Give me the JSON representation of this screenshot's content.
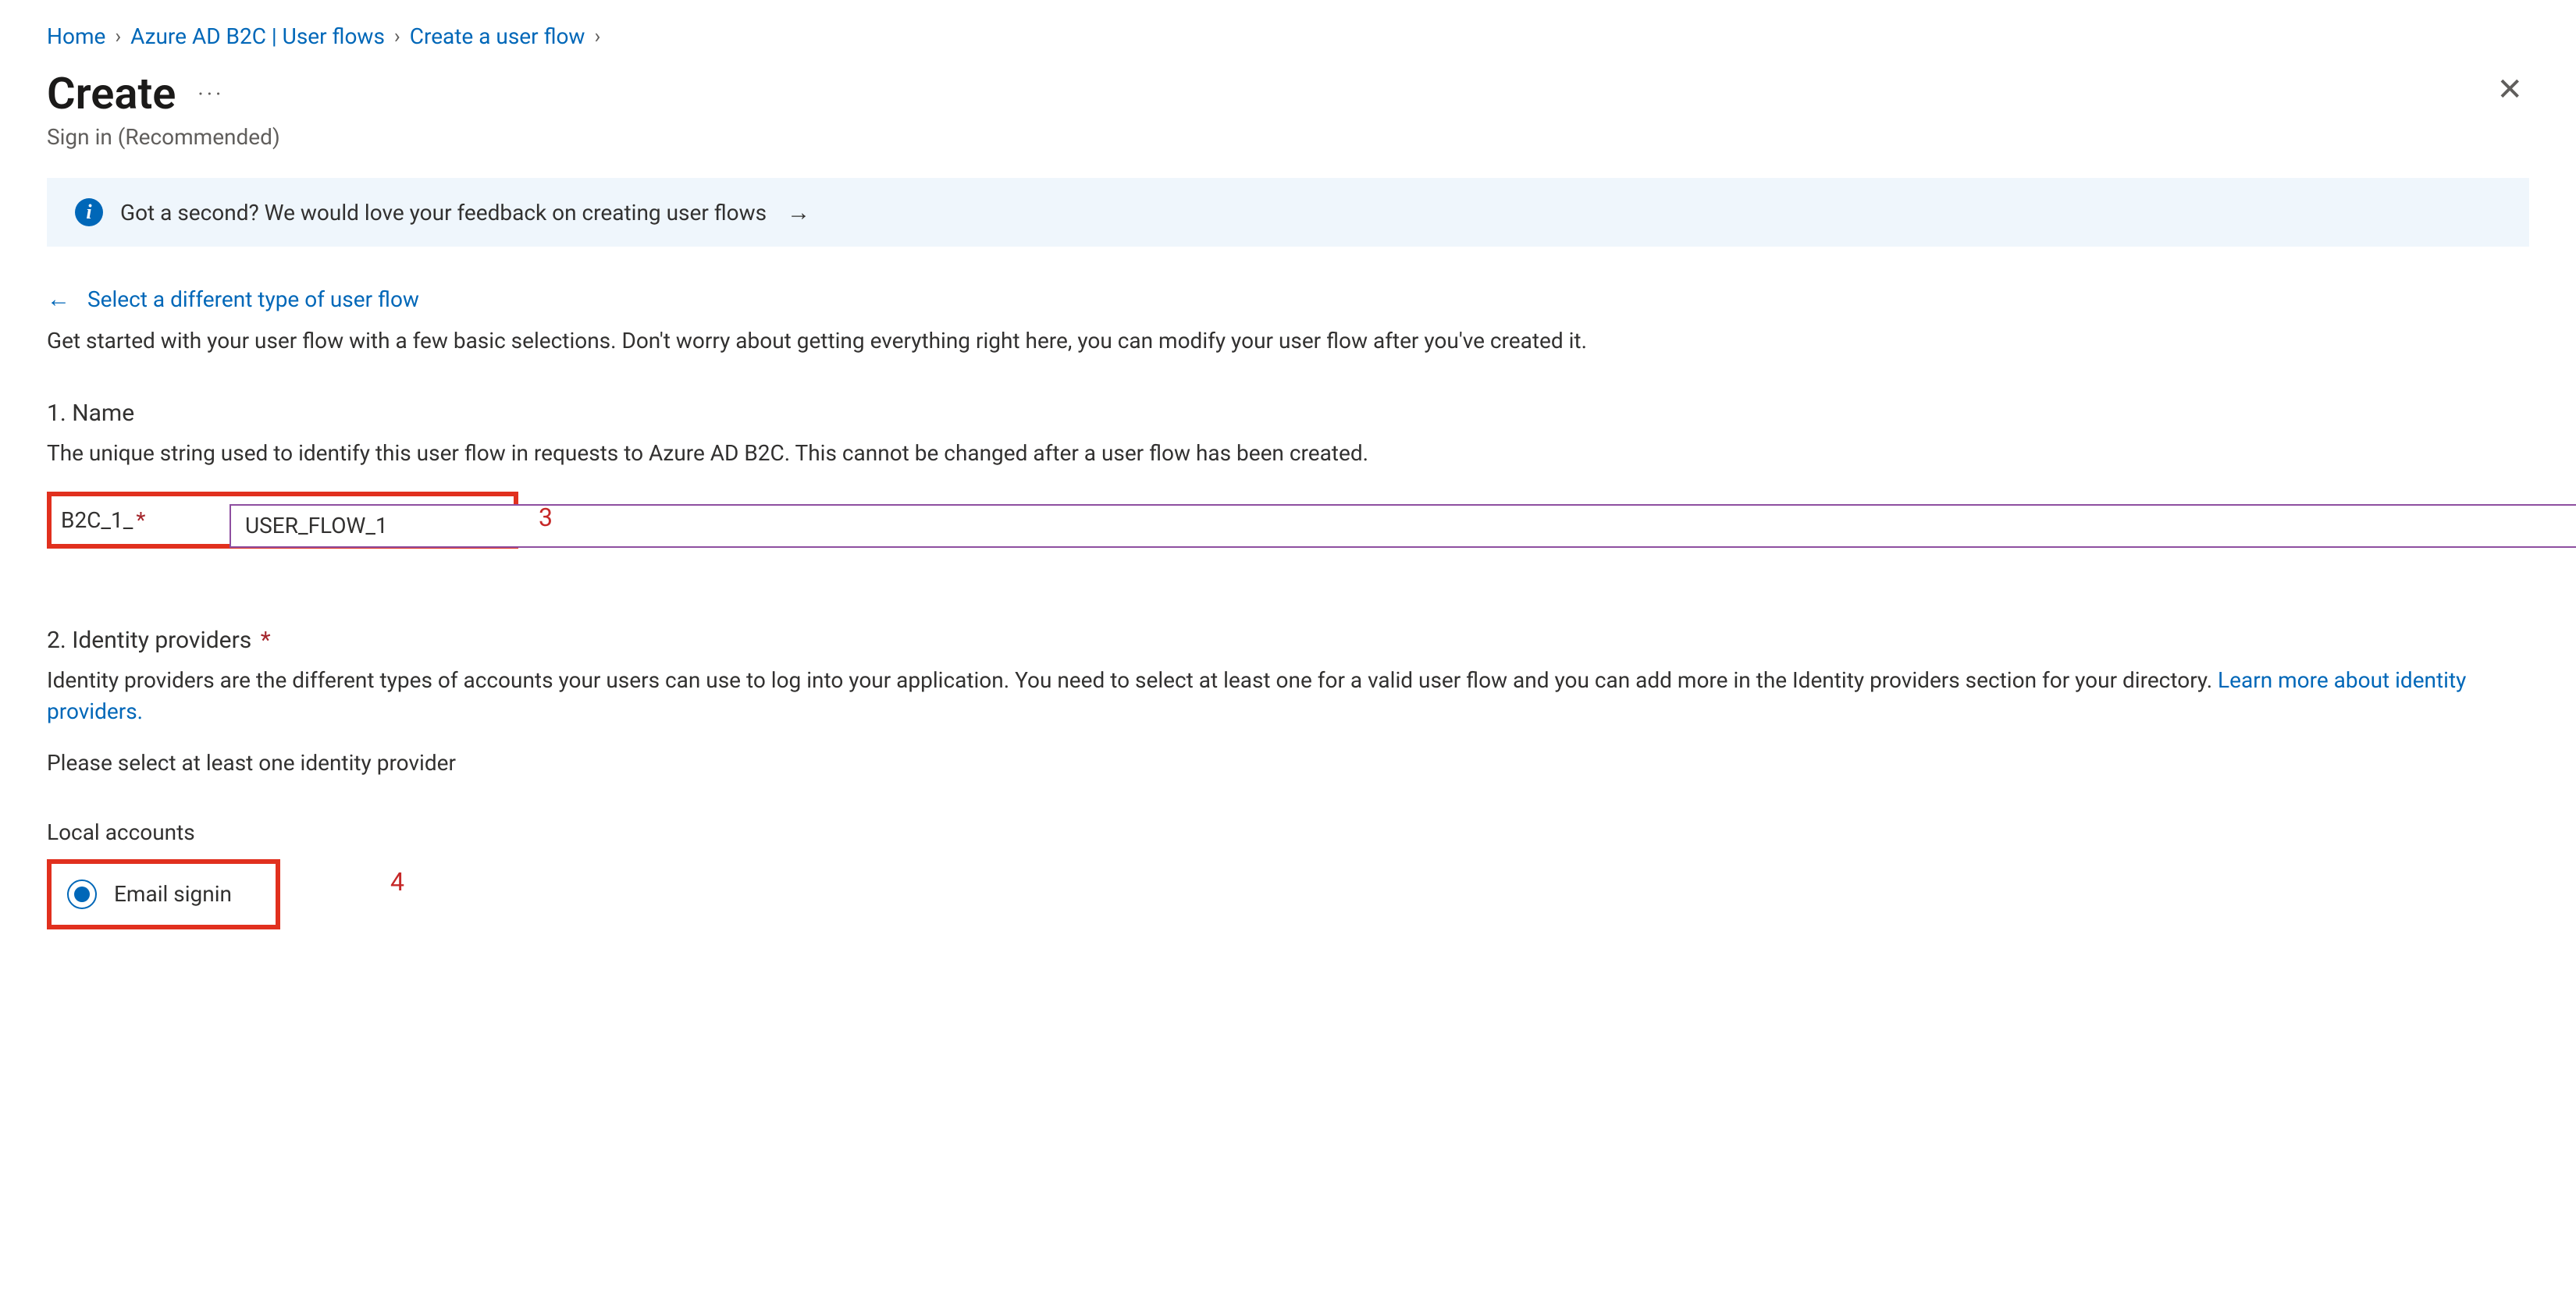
{
  "breadcrumb": {
    "items": [
      "Home",
      "Azure AD B2C | User flows",
      "Create a user flow"
    ]
  },
  "header": {
    "title": "Create",
    "subtitle": "Sign in (Recommended)"
  },
  "feedback": {
    "text": "Got a second? We would love your feedback on creating user flows"
  },
  "back_link": "Select a different type of user flow",
  "intro": "Get started with your user flow with a few basic selections. Don't worry about getting everything right here, you can modify your user flow after you've created it.",
  "section1": {
    "title": "1. Name",
    "desc": "The unique string used to identify this user flow in requests to Azure AD B2C. This cannot be changed after a user flow has been created.",
    "prefix": "B2C_1_",
    "value": "USER_FLOW_1"
  },
  "section2": {
    "title": "2. Identity providers",
    "desc_pre": "Identity providers are the different types of accounts your users can use to log into your application. You need to select at least one for a valid user flow and you can add more in the Identity providers section for your directory. ",
    "learn_link": "Learn more about identity providers.",
    "prompt": "Please select at least one identity provider",
    "local_label": "Local accounts",
    "radio_label": "Email signin"
  },
  "annotations": {
    "step3": "3",
    "step4": "4"
  }
}
